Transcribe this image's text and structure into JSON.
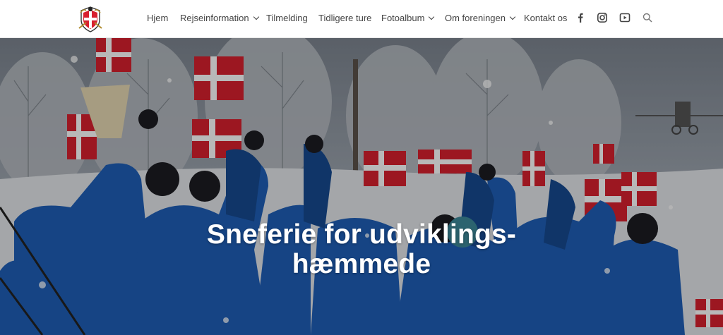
{
  "colors": {
    "nav_text": "#444444",
    "hero_overlay": "#000000",
    "jacket_blue": "#1f5fb8",
    "flag_red": "#d8202f",
    "flag_white": "#ffffff"
  },
  "header": {
    "logo_icon": "association-crest-logo",
    "nav": [
      {
        "label": "Hjem",
        "dropdown": false
      },
      {
        "label": "Rejseinformation",
        "dropdown": true
      },
      {
        "label": "Tilmelding",
        "dropdown": false
      },
      {
        "label": "Tidligere ture",
        "dropdown": false
      },
      {
        "label": "Fotoalbum",
        "dropdown": true
      },
      {
        "label": "Om foreningen",
        "dropdown": true
      },
      {
        "label": "Kontakt os",
        "dropdown": false
      }
    ],
    "icons": [
      "facebook-icon",
      "instagram-icon",
      "youtube-icon",
      "search-icon"
    ]
  },
  "hero": {
    "title_line1": "Sneferie for udviklings-",
    "title_line2": "hæmmede",
    "image": "group-in-blue-ski-jackets-waving-danish-flags-in-snow"
  }
}
